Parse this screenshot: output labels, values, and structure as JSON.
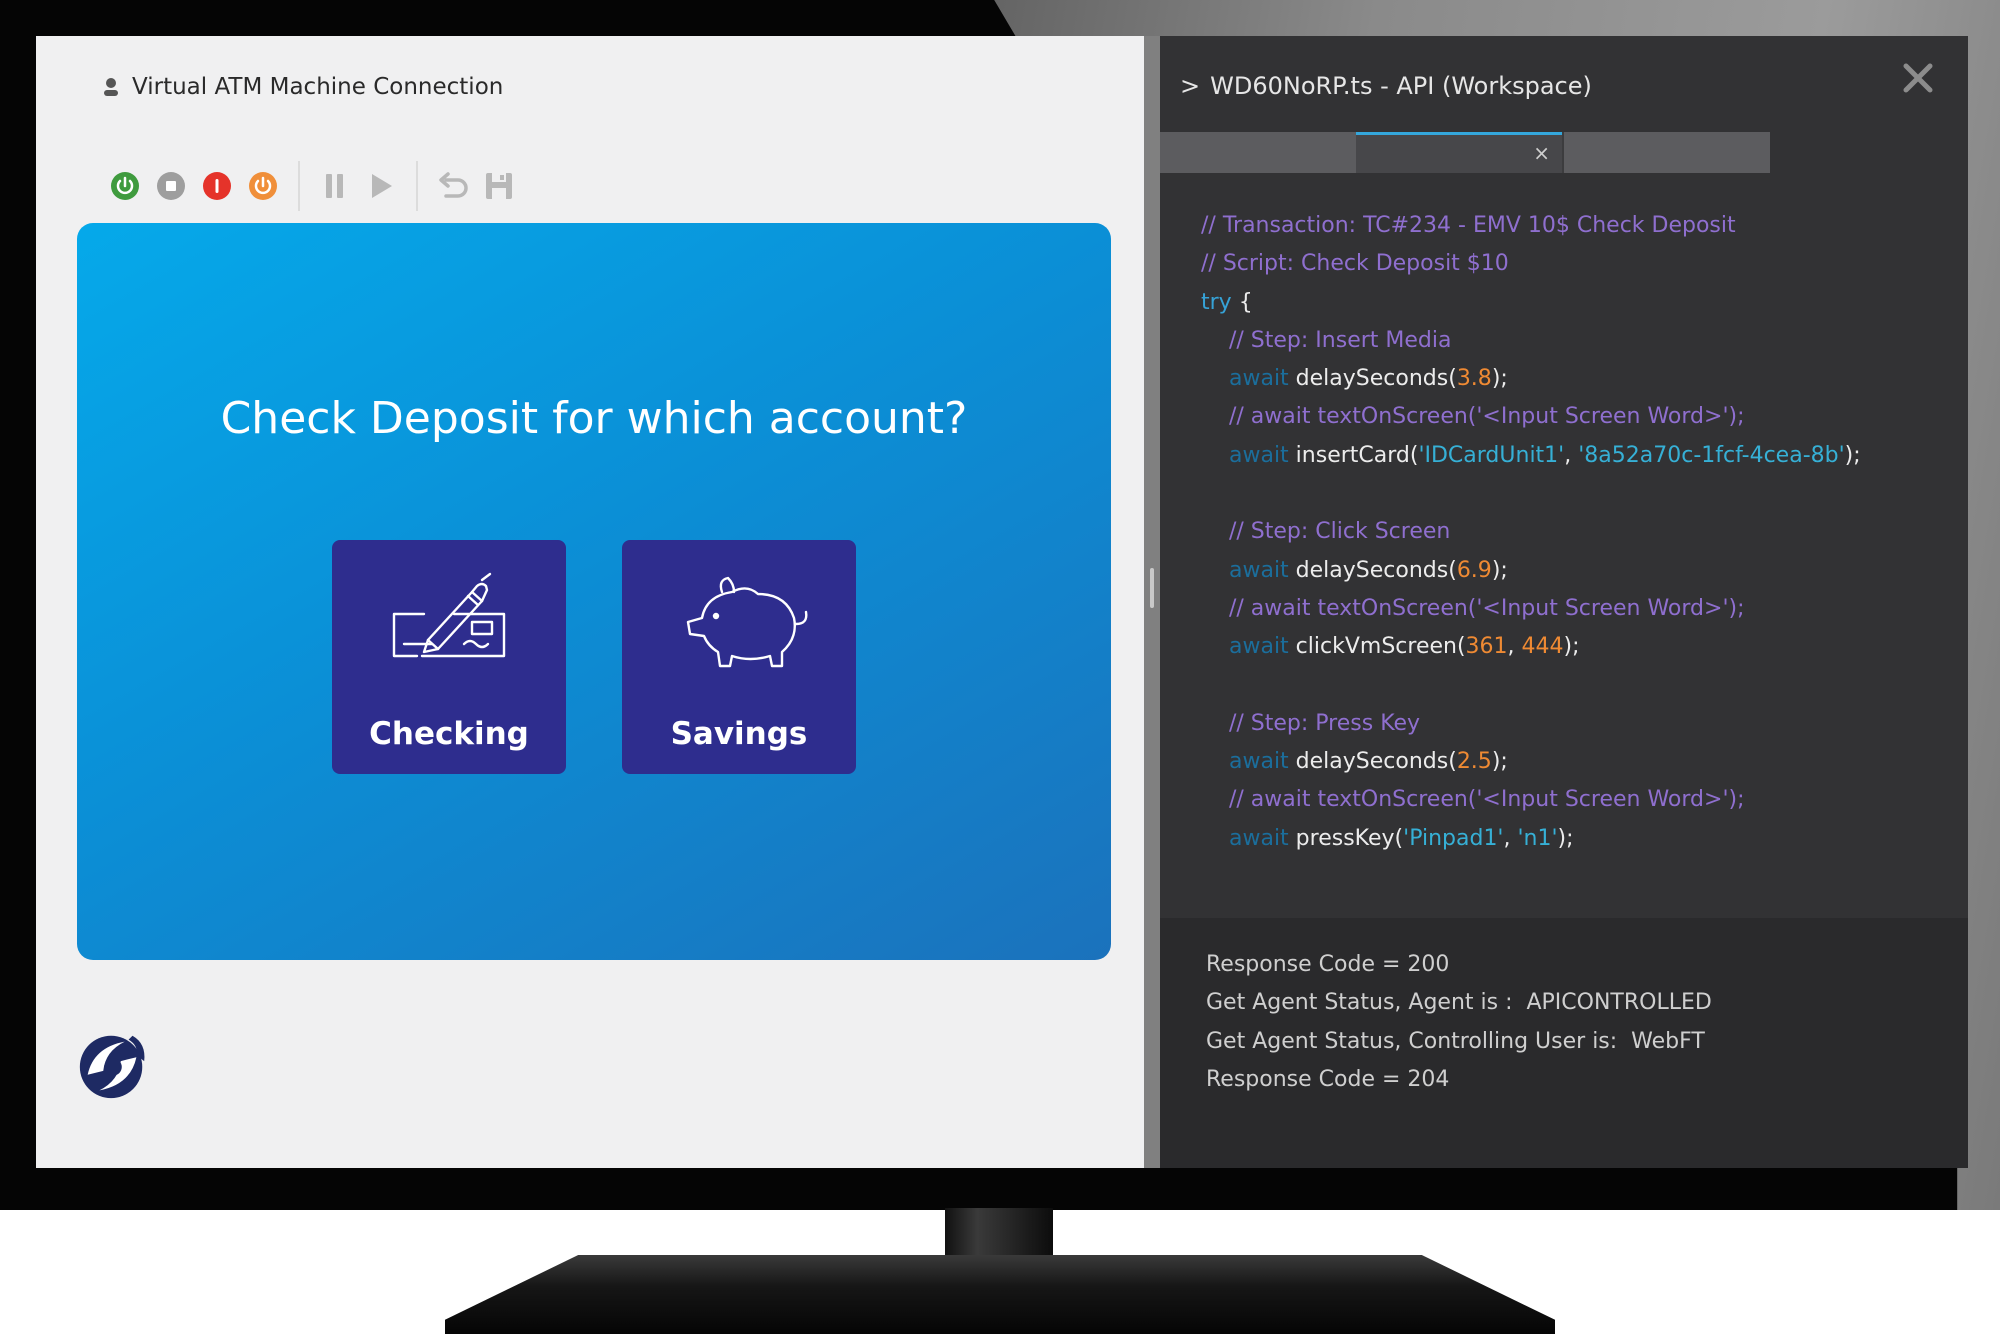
{
  "connection": {
    "title": "Virtual ATM Machine Connection",
    "user_icon": "user-icon"
  },
  "toolbar": {
    "icons": [
      "power-on-icon",
      "stop-icon",
      "error-icon",
      "power-off-icon",
      "pause-icon",
      "play-icon",
      "undo-icon",
      "save-icon"
    ],
    "colors": {
      "power_on": "#3f9b3e",
      "stop": "#9e9e9e",
      "error": "#e5332a",
      "power_off": "#f08f3a"
    }
  },
  "atm": {
    "prompt": "Check Deposit for which account?",
    "buttons": [
      {
        "label": "Checking",
        "icon": "check-signing-icon"
      },
      {
        "label": "Savings",
        "icon": "piggy-bank-icon"
      }
    ],
    "colors": {
      "screen": "#0b8fd6",
      "button": "#2e2d8e"
    }
  },
  "api_panel": {
    "title": "WD60NoRP.ts - API (Workspace)",
    "prefix": ">",
    "close_icon": "close-icon",
    "tab_close": "×"
  },
  "code": {
    "lines": [
      [
        {
          "t": "// Transaction: TC#234 - EMV 10$ Check Deposit",
          "c": "cm"
        }
      ],
      [
        {
          "t": "// Script: Check Deposit $10",
          "c": "cm"
        }
      ],
      [
        {
          "t": "try",
          "c": "kw"
        },
        {
          "t": " {",
          "c": "fn"
        }
      ],
      [
        {
          "t": "    ",
          "c": "fn"
        },
        {
          "t": "// Step: Insert Media",
          "c": "cm"
        }
      ],
      [
        {
          "t": "    ",
          "c": "fn"
        },
        {
          "t": "await",
          "c": "aw"
        },
        {
          "t": " delaySeconds(",
          "c": "fn"
        },
        {
          "t": "3.8",
          "c": "num"
        },
        {
          "t": ");",
          "c": "fn"
        }
      ],
      [
        {
          "t": "    ",
          "c": "fn"
        },
        {
          "t": "// await textOnScreen('<Input Screen Word>');",
          "c": "cm"
        }
      ],
      [
        {
          "t": "    ",
          "c": "fn"
        },
        {
          "t": "await",
          "c": "aw"
        },
        {
          "t": " insertCard(",
          "c": "fn"
        },
        {
          "t": "'IDCardUnit1'",
          "c": "str"
        },
        {
          "t": ", ",
          "c": "fn"
        },
        {
          "t": "'8a52a70c-1fcf-4cea-8b'",
          "c": "str"
        },
        {
          "t": ");",
          "c": "fn"
        }
      ],
      [],
      [
        {
          "t": "    ",
          "c": "fn"
        },
        {
          "t": "// Step: Click Screen",
          "c": "cm"
        }
      ],
      [
        {
          "t": "    ",
          "c": "fn"
        },
        {
          "t": "await",
          "c": "aw"
        },
        {
          "t": " delaySeconds(",
          "c": "fn"
        },
        {
          "t": "6.9",
          "c": "num"
        },
        {
          "t": ");",
          "c": "fn"
        }
      ],
      [
        {
          "t": "    ",
          "c": "fn"
        },
        {
          "t": "// await textOnScreen('<Input Screen Word>');",
          "c": "cm"
        }
      ],
      [
        {
          "t": "    ",
          "c": "fn"
        },
        {
          "t": "await",
          "c": "aw"
        },
        {
          "t": " clickVmScreen(",
          "c": "fn"
        },
        {
          "t": "361",
          "c": "num"
        },
        {
          "t": ", ",
          "c": "fn"
        },
        {
          "t": "444",
          "c": "num"
        },
        {
          "t": ");",
          "c": "fn"
        }
      ],
      [],
      [
        {
          "t": "    ",
          "c": "fn"
        },
        {
          "t": "// Step: Press Key",
          "c": "cm"
        }
      ],
      [
        {
          "t": "    ",
          "c": "fn"
        },
        {
          "t": "await",
          "c": "aw"
        },
        {
          "t": " delaySeconds(",
          "c": "fn"
        },
        {
          "t": "2.5",
          "c": "num"
        },
        {
          "t": ");",
          "c": "fn"
        }
      ],
      [
        {
          "t": "    ",
          "c": "fn"
        },
        {
          "t": "// await textOnScreen('<Input Screen Word>');",
          "c": "cm"
        }
      ],
      [
        {
          "t": "    ",
          "c": "fn"
        },
        {
          "t": "await",
          "c": "aw"
        },
        {
          "t": " pressKey(",
          "c": "fn"
        },
        {
          "t": "'Pinpad1'",
          "c": "str"
        },
        {
          "t": ", ",
          "c": "fn"
        },
        {
          "t": "'n1'",
          "c": "str"
        },
        {
          "t": ");",
          "c": "fn"
        }
      ]
    ]
  },
  "output": {
    "lines": [
      "Response Code = 200",
      "Get Agent Status, Agent is :  APICONTROLLED",
      "Get Agent Status, Controlling User is:  WebFT",
      "Response Code = 204"
    ]
  },
  "brand": {
    "logo": "company-logo-icon"
  }
}
